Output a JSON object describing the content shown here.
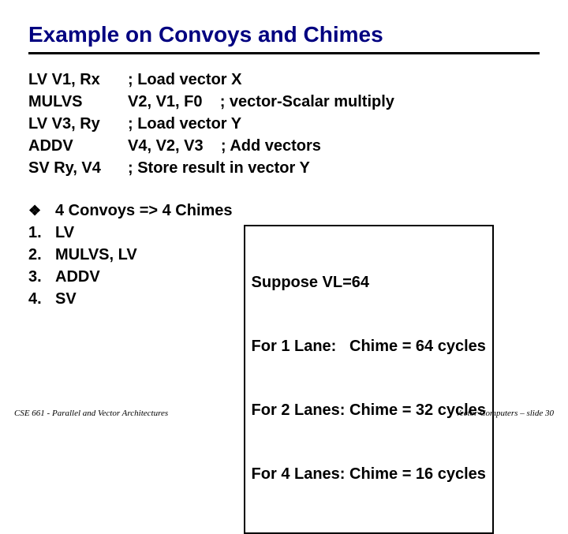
{
  "title": "Example on Convoys and Chimes",
  "instr": [
    {
      "left": "LV V1, Rx",
      "right": "; Load vector X"
    },
    {
      "left": "MULVS",
      "right": "V2, V1, F0    ; vector-Scalar multiply"
    },
    {
      "left": "LV V3, Ry",
      "right": "; Load vector Y"
    },
    {
      "left": "ADDV",
      "right": "V4, V2, V3    ; Add vectors"
    },
    {
      "left": "SV Ry, V4",
      "right": "; Store result in vector Y"
    }
  ],
  "convoys": {
    "heading_bullet": "❖",
    "heading": "4 Convoys => 4 Chimes",
    "items": [
      {
        "n": "1.",
        "t": "LV"
      },
      {
        "n": "2.",
        "t": "MULVS, LV"
      },
      {
        "n": "3.",
        "t": "ADDV"
      },
      {
        "n": "4.",
        "t": "SV"
      }
    ]
  },
  "suppose": {
    "l1": "Suppose VL=64",
    "l2": "For 1 Lane:   Chime = 64 cycles",
    "l3": "For 2 Lanes: Chime = 32 cycles",
    "l4": "For 4 Lanes: Chime = 16 cycles"
  },
  "footer": {
    "left": "CSE 661 - Parallel and Vector Architectures",
    "right": "Vector Computers – slide 30"
  }
}
